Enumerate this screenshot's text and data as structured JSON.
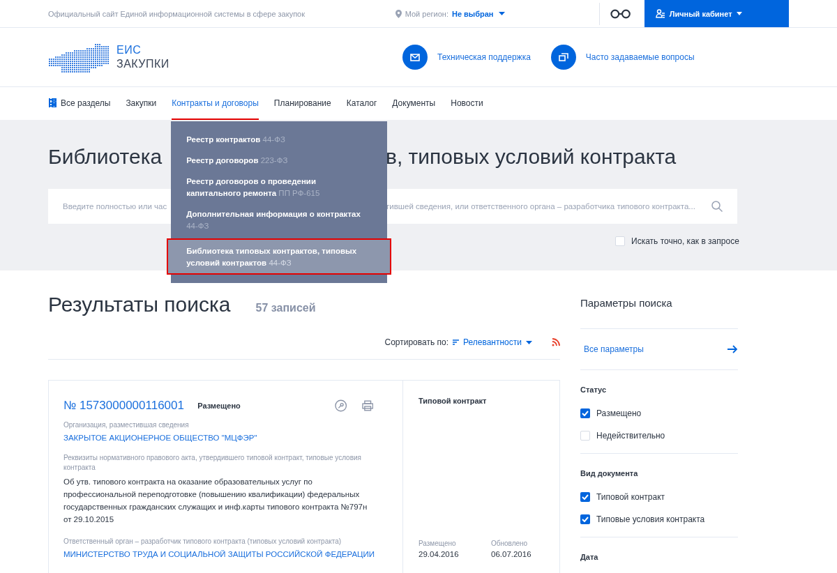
{
  "top_bar": {
    "site_title": "Официальный сайт Единой информационной системы в сфере закупок",
    "region_label": "Мой регион:",
    "region_value": "Не выбран",
    "account_button": "Личный кабинет"
  },
  "header": {
    "logo_line1": "ЕИС",
    "logo_line2": "ЗАКУПКИ",
    "links": [
      {
        "kind": "mail",
        "label": "Техническая поддержка"
      },
      {
        "kind": "faq",
        "label": "Часто задаваемые вопросы"
      }
    ]
  },
  "nav": [
    {
      "label": "Все разделы",
      "kind": "all",
      "selected": false
    },
    {
      "label": "Закупки",
      "kind": "plain",
      "selected": false
    },
    {
      "label": "Контракты и договоры",
      "kind": "plain",
      "selected": true
    },
    {
      "label": "Планирование",
      "kind": "plain",
      "selected": false
    },
    {
      "label": "Каталог",
      "kind": "plain",
      "selected": false
    },
    {
      "label": "Документы",
      "kind": "plain",
      "selected": false
    },
    {
      "label": "Новости",
      "kind": "plain",
      "selected": false
    }
  ],
  "dropdown": [
    {
      "label": "Реестр контрактов",
      "law": "44-ФЗ",
      "selected": false
    },
    {
      "label": "Реестр договоров",
      "law": "223-ФЗ",
      "selected": false
    },
    {
      "label": "Реестр договоров о проведении капитального ремонта",
      "law": "ПП РФ-615",
      "selected": false
    },
    {
      "label": "Дополнительная информация о контрактах",
      "law": "44-ФЗ",
      "selected": false
    },
    {
      "label": "Библиотека типовых контрактов, типовых условий контрактов",
      "law": "44-ФЗ",
      "selected": true
    }
  ],
  "banner": {
    "title_parts": [
      "Библиотека",
      "в, типовых условий контракта"
    ],
    "placeholder_parts": [
      "Введите полностью или час",
      "тившей сведения, или ответственного органа – разработчика типового контракта..."
    ],
    "exact_search": {
      "label": "Искать точно, как в запросе",
      "checked": false
    }
  },
  "results": {
    "title": "Результаты поиска",
    "count": "57 записей",
    "sort_label": "Сортировать по:",
    "sort_value": "Релевантности"
  },
  "card": {
    "number": "№ 1573000000116001",
    "status": "Размещено",
    "org_label": "Организация, разместившая сведения",
    "org_value": "ЗАКРЫТОЕ АКЦИОНЕРНОЕ ОБЩЕСТВО \"МЦФЭР\"",
    "act_label": "Реквизиты нормативного правового акта, утвердившего типовой контракт, типовые условия контракта",
    "act_value": "Об утв. типового контракта на оказание образовательных услуг по профессиональной переподготовке (повышению квалификации) федеральных государственных гражданских служащих и инф.карты типового контракта №797н от 29.10.2015",
    "body_label": "Ответственный орган – разработчик типового контракта (типовых условий контракта)",
    "body_value": "МИНИСТЕРСТВО ТРУДА И СОЦИАЛЬНОЙ ЗАЩИТЫ РОССИЙСКОЙ ФЕДЕРАЦИИ",
    "doc_type": "Типовой контракт",
    "dates": [
      {
        "label": "Размещено",
        "value": "29.04.2016"
      },
      {
        "label": "Обновлено",
        "value": "06.07.2016"
      }
    ]
  },
  "sidebar": {
    "title": "Параметры поиска",
    "all_params": "Все параметры",
    "groups": [
      {
        "title": "Статус",
        "options": [
          {
            "label": "Размещено",
            "checked": true
          },
          {
            "label": "Недействительно",
            "checked": false
          }
        ]
      },
      {
        "title": "Вид документа",
        "options": [
          {
            "label": "Типовой контракт",
            "checked": true
          },
          {
            "label": "Типовые условия контракта",
            "checked": true
          }
        ]
      },
      {
        "title": "Дата"
      }
    ]
  }
}
